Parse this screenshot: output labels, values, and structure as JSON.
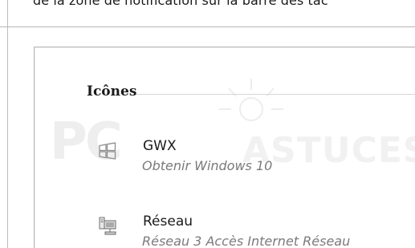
{
  "intro": {
    "text": "de la zone de notification sur la barre des tâc"
  },
  "panel": {
    "section_title": "Icônes",
    "items": [
      {
        "icon": "windows-logo-icon",
        "title": "GWX",
        "subtitle": "Obtenir Windows 10"
      },
      {
        "icon": "network-icon",
        "title": "Réseau",
        "subtitle": "Réseau  3 Accès Internet Réseau"
      }
    ]
  },
  "watermark": {
    "left": "PC",
    "right": "ASTUCES"
  }
}
